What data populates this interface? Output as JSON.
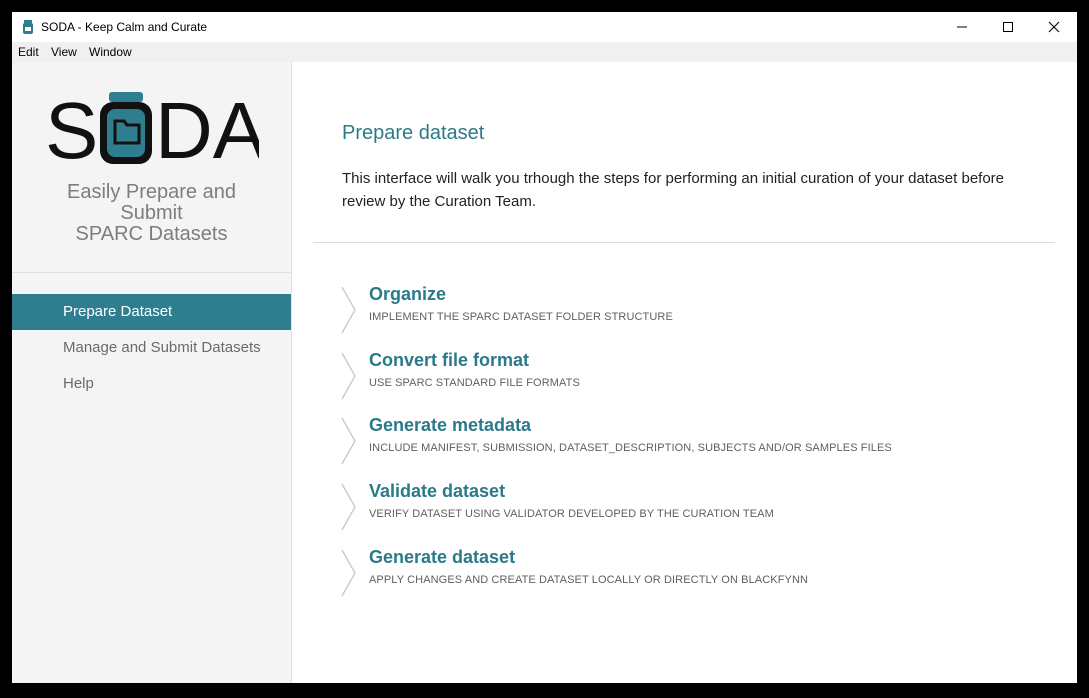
{
  "window": {
    "title": "SODA - Keep Calm and Curate"
  },
  "menubar": {
    "items": [
      "Edit",
      "View",
      "Window"
    ]
  },
  "sidebar": {
    "logo_text": "SODA",
    "tagline": [
      "Easily Prepare and",
      "Submit",
      "SPARC Datasets"
    ],
    "nav": [
      {
        "label": "Prepare Dataset",
        "active": true
      },
      {
        "label": "Manage and Submit Datasets",
        "active": false
      },
      {
        "label": "Help",
        "active": false
      }
    ]
  },
  "main": {
    "title": "Prepare dataset",
    "intro": "This interface will walk you trhough the steps for performing an initial curation of your dataset before review by the Curation Team.",
    "steps": [
      {
        "title": "Organize",
        "subtitle": "IMPLEMENT THE SPARC DATASET FOLDER STRUCTURE"
      },
      {
        "title": "Convert file format",
        "subtitle": "USE SPARC STANDARD FILE FORMATS"
      },
      {
        "title": "Generate metadata",
        "subtitle": "INCLUDE MANIFEST, SUBMISSION, DATASET_DESCRIPTION, SUBJECTS AND/OR SAMPLES FILES"
      },
      {
        "title": "Validate dataset",
        "subtitle": "VERIFY DATASET USING VALIDATOR DEVELOPED BY THE CURATION TEAM"
      },
      {
        "title": "Generate dataset",
        "subtitle": "APPLY CHANGES AND CREATE DATASET LOCALLY OR DIRECTLY ON BLACKFYNN"
      }
    ]
  },
  "colors": {
    "accent": "#2e7e8f",
    "title": "#2b7a8a",
    "sidebar_bg": "#f4f4f4"
  },
  "icons": {
    "app": "soda-jar-icon",
    "minimize": "minimize-icon",
    "maximize": "maximize-icon",
    "close": "close-icon",
    "step": "chevron-right-icon"
  }
}
